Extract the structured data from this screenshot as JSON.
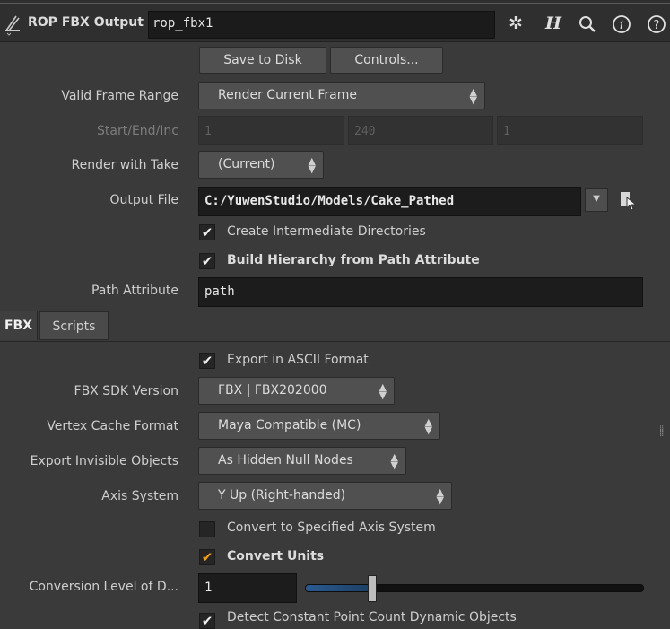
{
  "header": {
    "node_type": "ROP FBX Output",
    "node_name": "rop_fbx1",
    "icons": [
      "node-icon",
      "gear-icon",
      "help-h-icon",
      "search-icon",
      "info-icon",
      "question-icon"
    ]
  },
  "toolbar": {
    "save_label": "Save to Disk",
    "controls_label": "Controls..."
  },
  "params": {
    "valid_frame_range": {
      "label": "Valid Frame Range",
      "value": "Render Current Frame"
    },
    "start_end_inc": {
      "label": "Start/End/Inc",
      "values": [
        "1",
        "240",
        "1"
      ]
    },
    "render_with_take": {
      "label": "Render with Take",
      "value": "(Current)"
    },
    "output_file": {
      "label": "Output File",
      "value": "C:/YuwenStudio/Models/Cake_Pathed"
    },
    "create_dirs": {
      "label": "Create Intermediate Directories",
      "checked": true
    },
    "build_hierarchy": {
      "label": "Build Hierarchy from Path Attribute",
      "checked": true
    },
    "path_attribute": {
      "label": "Path Attribute",
      "value": "path"
    }
  },
  "tabs": [
    {
      "label": "FBX",
      "active": true
    },
    {
      "label": "Scripts",
      "active": false
    }
  ],
  "fbx": {
    "export_ascii": {
      "label": "Export in ASCII Format",
      "checked": true
    },
    "sdk_version": {
      "label": "FBX SDK Version",
      "value": "FBX | FBX202000"
    },
    "vertex_cache": {
      "label": "Vertex Cache Format",
      "value": "Maya Compatible (MC)"
    },
    "invisible_objects": {
      "label": "Export Invisible Objects",
      "value": "As Hidden Null Nodes"
    },
    "axis_system": {
      "label": "Axis System",
      "value": "Y Up (Right-handed)"
    },
    "convert_axis": {
      "label": "Convert to Specified Axis System",
      "checked": false
    },
    "convert_units": {
      "label": "Convert Units",
      "checked": true
    },
    "conversion_level": {
      "label": "Conversion Level of D...",
      "value": "1",
      "slider_fraction": 0.2
    },
    "detect_constant": {
      "label": "Detect Constant Point Count Dynamic Objects",
      "checked": true
    }
  },
  "colors": {
    "accent_check": "#f0a020",
    "slider_fill": "#2a5a90",
    "background": "#3a3a3a"
  }
}
